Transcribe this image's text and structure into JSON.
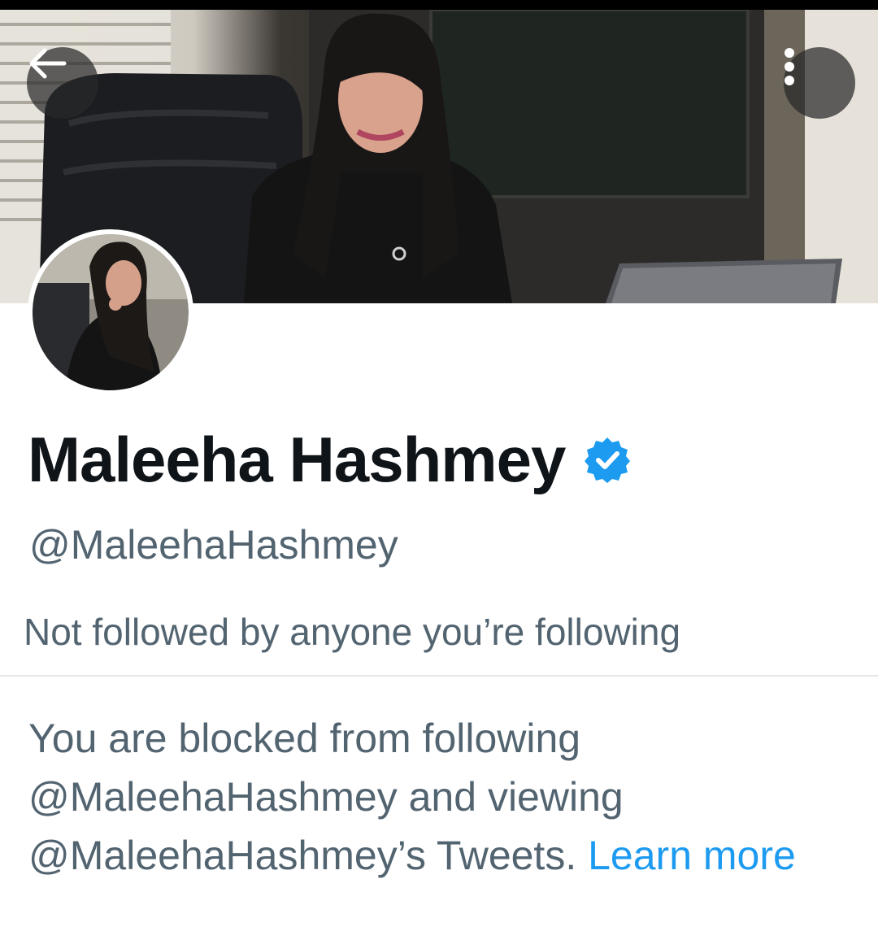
{
  "header": {
    "back_icon": "arrow-left-icon",
    "more_icon": "vertical-dots-icon"
  },
  "profile": {
    "display_name": "Maleeha Hashmey",
    "verified_icon": "verified-badge-icon",
    "verified_color": "#1d9bf0",
    "handle": "@MaleehaHashmey",
    "followers_note": "Not followed by anyone you’re following"
  },
  "blocked_notice": {
    "text": "You are blocked from following @MaleehaHashmey and viewing @MaleehaHashmey’s Tweets.",
    "link_label": "Learn more",
    "link_color": "#1d9bf0"
  },
  "colors": {
    "primary_text": "#0f1419",
    "secondary_text": "#536471",
    "divider": "#e1e6ea"
  }
}
